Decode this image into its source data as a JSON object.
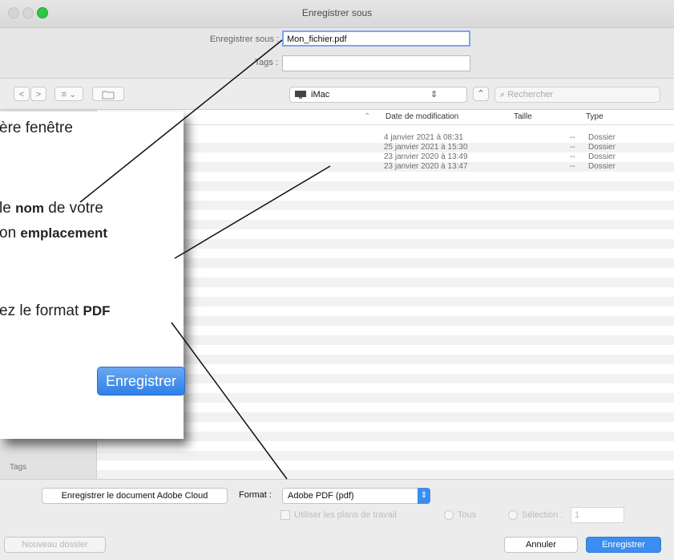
{
  "window": {
    "title": "Enregistrer sous"
  },
  "save_as": {
    "label": "Enregistrer sous :",
    "value": "Mon_fichier.pdf"
  },
  "tags_field": {
    "label": "Tags :",
    "value": ""
  },
  "toolbar": {
    "back": "<",
    "forward": ">",
    "view": "≡ ⌄",
    "new_folder_icon": "folder-icon"
  },
  "location": {
    "value": "iMac"
  },
  "search": {
    "placeholder": "Rechercher"
  },
  "columns": {
    "date": "Date de modification",
    "size": "Taille",
    "type": "Type"
  },
  "rows": [
    {
      "date": "4 janvier 2021 à 08:31",
      "size": "--",
      "type": "Dossier"
    },
    {
      "date": "25 janvier 2021 à 15:30",
      "size": "--",
      "type": "Dossier"
    },
    {
      "date": "23 janvier 2020 à 13:49",
      "size": "--",
      "type": "Dossier"
    },
    {
      "date": "23 janvier 2020 à 13:47",
      "size": "--",
      "type": "Dossier"
    }
  ],
  "sidebar": {
    "tags_label": "Tags"
  },
  "bottom": {
    "cloud_button": "Enregistrer le document Adobe Cloud",
    "format_label": "Format :",
    "format_value": "Adobe PDF (pdf)",
    "artboards_label": "Utiliser les plans de travail",
    "all_label": "Tous",
    "selection_label": "Sélection :",
    "selection_value": "1",
    "new_folder": "Nouveau dossier",
    "cancel": "Annuler",
    "save": "Enregistrer"
  },
  "callout": {
    "line1": "ère fenêtre",
    "line2_pre": "le ",
    "line2_bold": "nom",
    "line2_post": " de votre",
    "line3_pre": "on ",
    "line3_bold": "emplacement",
    "line4_pre": "ez le format ",
    "line4_bold": "PDF",
    "button": "Enregistrer"
  },
  "colors": {
    "accent": "#3b8ef0",
    "traffic_close": "#d7d7d7",
    "traffic_zoom": "#2bc840"
  }
}
